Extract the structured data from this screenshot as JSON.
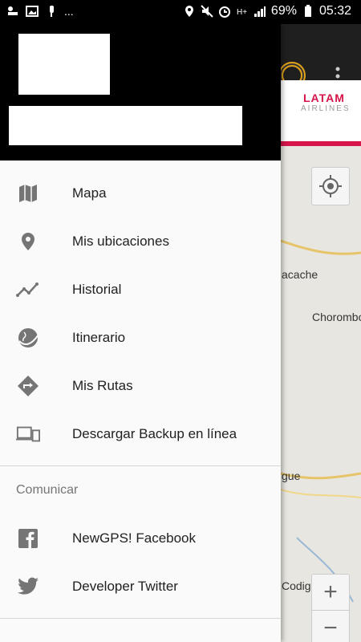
{
  "status_bar": {
    "battery": "69%",
    "time": "05:32",
    "dots": "..."
  },
  "map": {
    "ad_brand": "LATAM",
    "ad_sub": "AIRLINES",
    "labels": [
      "acache",
      "Chorombo",
      "gue",
      "Codigua"
    ],
    "zoom_in": "+",
    "zoom_out": "−"
  },
  "drawer": {
    "menu": [
      {
        "label": "Mapa",
        "icon": "map-icon"
      },
      {
        "label": "Mis ubicaciones",
        "icon": "location-pin-icon"
      },
      {
        "label": "Historial",
        "icon": "history-line-icon"
      },
      {
        "label": "Itinerario",
        "icon": "globe-plane-icon"
      },
      {
        "label": "Mis Rutas",
        "icon": "route-sign-icon"
      },
      {
        "label": "Descargar Backup en línea",
        "icon": "devices-icon"
      }
    ],
    "section_title": "Comunicar",
    "social": [
      {
        "label": "NewGPS! Facebook",
        "icon": "facebook-icon"
      },
      {
        "label": "Developer Twitter",
        "icon": "twitter-icon"
      }
    ]
  }
}
